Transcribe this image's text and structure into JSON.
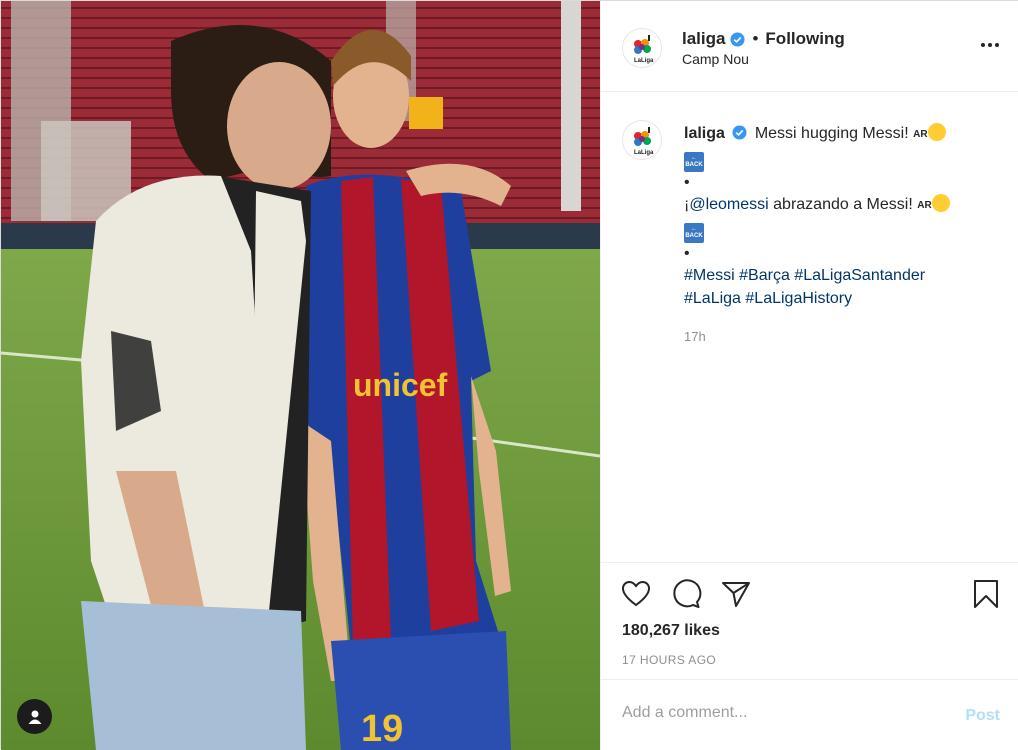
{
  "header": {
    "username": "laliga",
    "separator": "•",
    "follow_status": "Following",
    "location": "Camp Nou",
    "more_icon": "more-options-icon"
  },
  "caption": {
    "username": "laliga",
    "line1": "Messi hugging Messi!",
    "ar_label": "AR",
    "back_label": "BACK",
    "bullet": "•",
    "line2_prefix": "¡",
    "line2_mention": "@leomessi",
    "line2_rest": " abrazando a Messi!",
    "hashtags_row1": [
      "#Messi",
      "#Barça",
      "#LaLigaSantander"
    ],
    "hashtags_row2": [
      "#LaLiga",
      "#LaLigaHistory"
    ],
    "time": "17h"
  },
  "actions": {
    "like_icon": "heart-icon",
    "comment_icon": "comment-icon",
    "share_icon": "paper-plane-icon",
    "save_icon": "bookmark-icon",
    "likes": "180,267 likes",
    "timestamp": "17 HOURS AGO"
  },
  "comment": {
    "placeholder": "Add a comment...",
    "post_label": "Post"
  },
  "colors": {
    "link": "#00376b",
    "verified": "#3897f0",
    "post_disabled": "#b2dffc",
    "muted": "#8e8e8e"
  }
}
